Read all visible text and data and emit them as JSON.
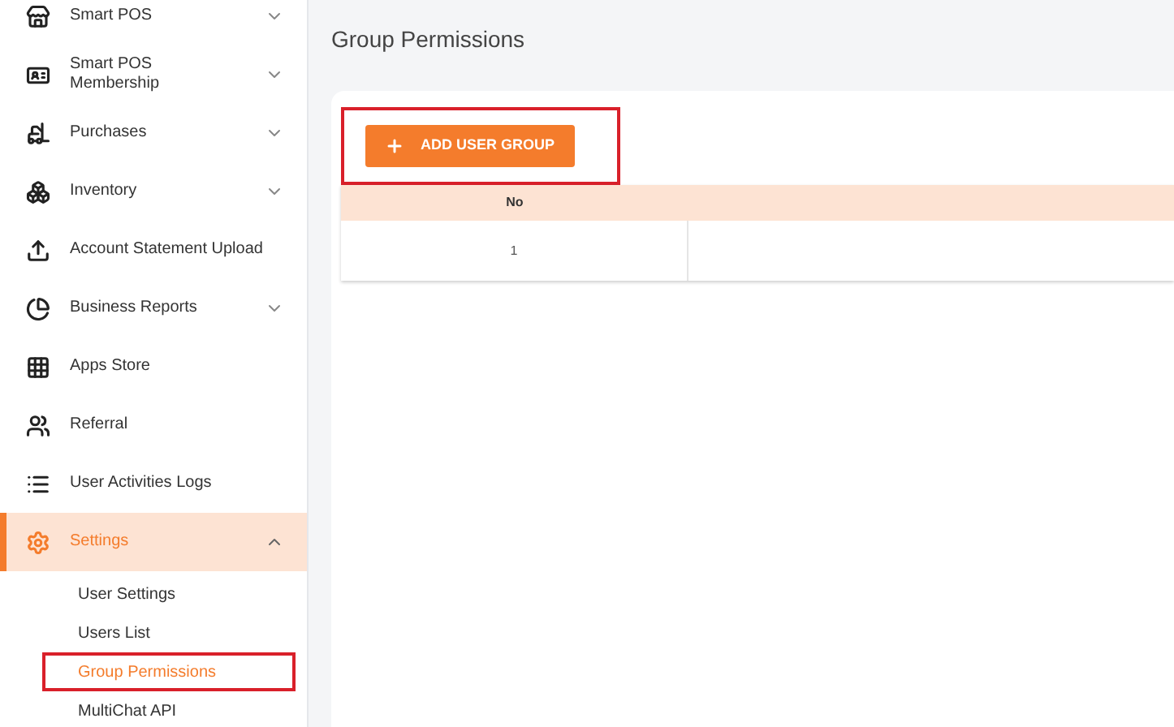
{
  "sidebar": {
    "items": [
      {
        "label": "Smart POS",
        "expanded": false,
        "selected": false
      },
      {
        "label": "Smart POS Membership",
        "expanded": false,
        "selected": false
      },
      {
        "label": "Purchases",
        "expanded": false,
        "selected": false
      },
      {
        "label": "Inventory",
        "expanded": false,
        "selected": false
      },
      {
        "label": "Account Statement Upload",
        "selected": false
      },
      {
        "label": "Business Reports",
        "expanded": false,
        "selected": false
      },
      {
        "label": "Apps Store",
        "selected": false
      },
      {
        "label": "Referral",
        "selected": false
      },
      {
        "label": "User Activities Logs",
        "selected": false
      },
      {
        "label": "Settings",
        "expanded": true,
        "selected": true,
        "children": [
          {
            "label": "User Settings",
            "selected": false,
            "highlighted": false
          },
          {
            "label": "Users List",
            "selected": false,
            "highlighted": false
          },
          {
            "label": "Group Permissions",
            "selected": true,
            "highlighted": true
          },
          {
            "label": "MultiChat API",
            "selected": false,
            "highlighted": false
          }
        ]
      }
    ]
  },
  "main": {
    "title": "Group Permissions",
    "add_button": {
      "label": "ADD USER GROUP",
      "highlighted": true
    },
    "table": {
      "columns": [
        "No"
      ],
      "rows": [
        [
          "1"
        ]
      ]
    }
  }
}
